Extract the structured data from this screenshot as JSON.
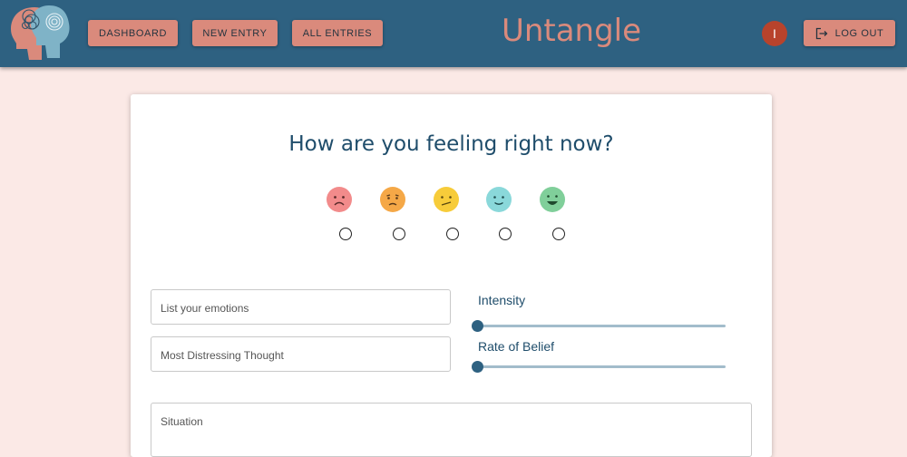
{
  "nav": {
    "dashboard_label": "DASHBOARD",
    "new_entry_label": "NEW ENTRY",
    "all_entries_label": "ALL ENTRIES",
    "app_title": "Untangle",
    "avatar_initial": "I",
    "logout_label": "LOG OUT"
  },
  "form": {
    "question": "How are you feeling right now?",
    "moods": [
      {
        "icon": "very-sad-face-icon",
        "color": "#f28b8b",
        "selected": false
      },
      {
        "icon": "sad-face-icon",
        "color": "#f5a847",
        "selected": false
      },
      {
        "icon": "neutral-face-icon",
        "color": "#f7cc3a",
        "selected": false
      },
      {
        "icon": "smile-face-icon",
        "color": "#8ad8da",
        "selected": false
      },
      {
        "icon": "happy-face-icon",
        "color": "#80cf9a",
        "selected": false
      }
    ],
    "emotions_placeholder": "List your emotions",
    "thought_placeholder": "Most Distressing Thought",
    "intensity_label": "Intensity",
    "intensity_value": 0,
    "belief_label": "Rate of Belief",
    "belief_value": 0,
    "situation_placeholder": "Situation"
  },
  "colors": {
    "header": "#2e6181",
    "accent": "#da8a7c",
    "background": "#fbe9e6",
    "heading_text": "#1f4d6b"
  }
}
